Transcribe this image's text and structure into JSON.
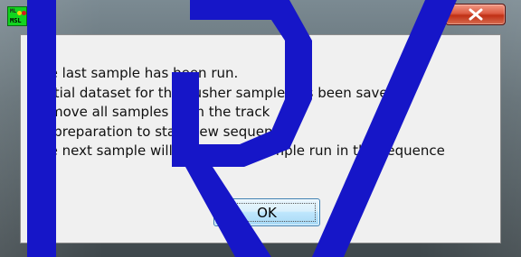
{
  "window": {
    "icon": {
      "name": "msl-app-icon",
      "text_top": "ML",
      "text_bottom": "MSL"
    },
    "close_button": {
      "icon": "close-x-icon"
    }
  },
  "dialog": {
    "message_lines": [
      "The last sample has been run.",
      "Partial dataset for the pusher sample has been saved.",
      "Remove all samples from the track",
      " in preparation to start new sequence.",
      "The next sample will be the first sample run in the sequence"
    ],
    "ok_label": "OK"
  },
  "overlay": {
    "mark": "watermark-slash-shape",
    "color": "#1616c8"
  }
}
